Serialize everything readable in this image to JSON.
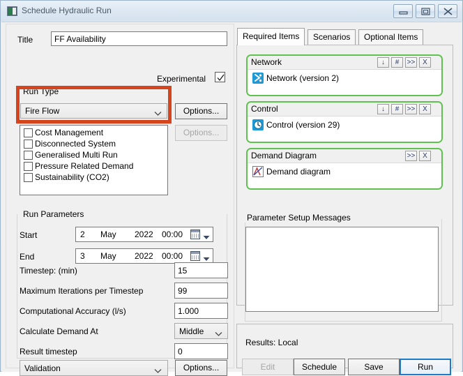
{
  "window": {
    "title": "Schedule Hydraulic Run",
    "icon": "app-icon",
    "controls": {
      "minimize": "minimize-icon",
      "maximize": "maximize-icon",
      "close": "close-icon"
    }
  },
  "colors": {
    "highlight": "#d4451e",
    "item_group_border": "#5fc14e",
    "default_button_border": "#1e7ac8"
  },
  "left": {
    "title_label": "Title",
    "title_value": "FF Availability",
    "title_placeholder": "",
    "experimental_label": "Experimental",
    "experimental_checked": true,
    "run_type": {
      "legend": "Run Type",
      "selected": "Fire Flow",
      "options_label": "Options..."
    },
    "features": {
      "options_label": "Options...",
      "items": [
        {
          "label": "Cost Management",
          "checked": false
        },
        {
          "label": "Disconnected System",
          "checked": false
        },
        {
          "label": "Generalised Multi Run",
          "checked": false
        },
        {
          "label": "Pressure Related Demand",
          "checked": false
        },
        {
          "label": "Sustainability (CO2)",
          "checked": false
        }
      ]
    },
    "run_parameters": {
      "legend": "Run Parameters",
      "start_label": "Start",
      "start": {
        "day": "2",
        "month": "May",
        "year": "2022",
        "time": "00:00"
      },
      "end_label": "End",
      "end": {
        "day": "3",
        "month": "May",
        "year": "2022",
        "time": "00:00"
      },
      "timestep_label": "Timestep: (min)",
      "timestep_value": "15",
      "max_iterations_label": "Maximum Iterations per Timestep",
      "max_iterations_value": "99",
      "accuracy_label": "Computational Accuracy (l/s)",
      "accuracy_value": "1.000",
      "demand_at_label": "Calculate Demand At",
      "demand_at_value": "Middle",
      "result_timestep_label": "Result timestep",
      "result_timestep_value": "0"
    },
    "validation": {
      "selected": "Validation",
      "options_label": "Options..."
    }
  },
  "right": {
    "tabs": [
      {
        "label": "Required Items",
        "active": true
      },
      {
        "label": "Scenarios",
        "active": false
      },
      {
        "label": "Optional Items",
        "active": false
      }
    ],
    "groups": [
      {
        "title": "Network",
        "buttons": [
          "↓",
          "#",
          ">>",
          "X"
        ],
        "item_label": "Network (version 2)",
        "item_icon": "network-icon"
      },
      {
        "title": "Control",
        "buttons": [
          "↓",
          "#",
          ">>",
          "X"
        ],
        "item_label": "Control (version 29)",
        "item_icon": "control-clock-icon"
      },
      {
        "title": "Demand Diagram",
        "buttons": [
          ">>",
          "X"
        ],
        "item_label": "Demand diagram",
        "item_icon": "demand-diagram-icon"
      }
    ],
    "messages": {
      "legend": "Parameter Setup Messages",
      "content": ""
    },
    "results": {
      "label": "Results: Local",
      "buttons": [
        {
          "label": "Edit",
          "state": "disabled"
        },
        {
          "label": "Schedule",
          "state": "normal"
        },
        {
          "label": "Save",
          "state": "normal"
        },
        {
          "label": "Run",
          "state": "default"
        }
      ]
    }
  }
}
